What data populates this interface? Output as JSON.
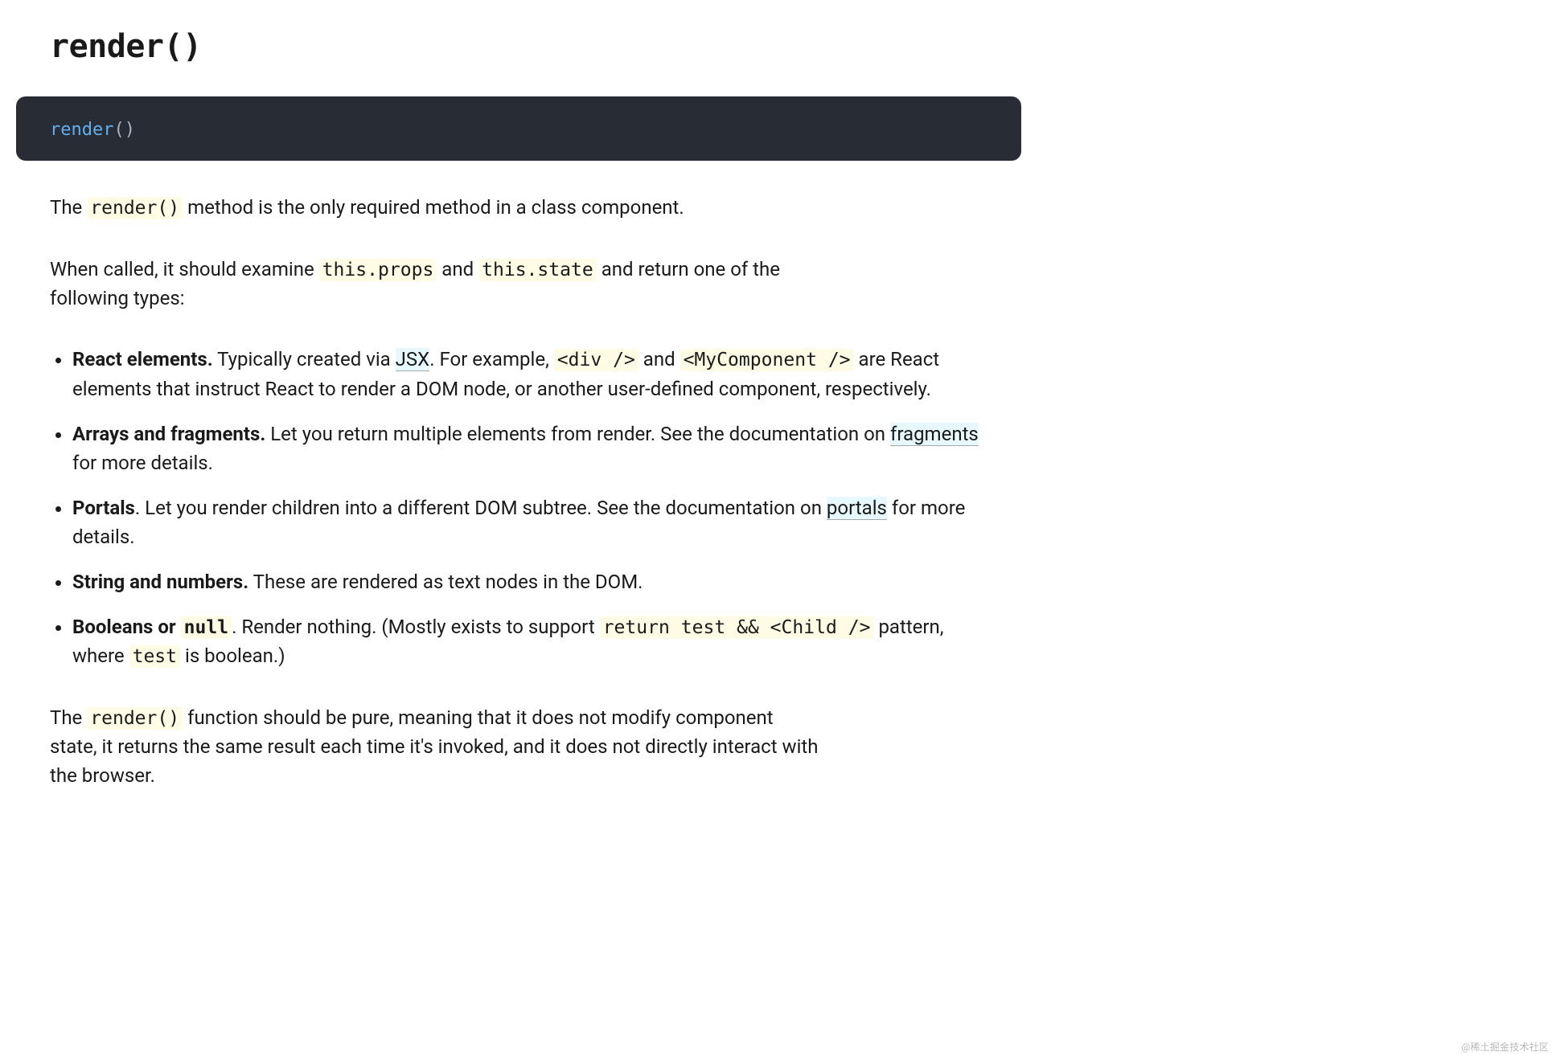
{
  "heading": "render()",
  "codeblock": {
    "fn": "render",
    "parens": "()"
  },
  "p1": {
    "before": "The ",
    "code": "render()",
    "after": " method is the only required method in a class component."
  },
  "p2": {
    "a": "When called, it should examine ",
    "code1": "this.props",
    "b": " and ",
    "code2": "this.state",
    "c": " and return one of the following types:"
  },
  "items": {
    "react_elements": {
      "label": "React elements.",
      "t1": " Typically created via ",
      "jsx": "JSX",
      "t2": ". For example, ",
      "code1": "<div />",
      "t3": " and ",
      "code2": "<MyComponent />",
      "t4": " are React elements that instruct React to render a DOM node, or another user-defined component, respectively."
    },
    "arrays": {
      "label": "Arrays and fragments.",
      "t1": " Let you return multiple elements from render. See the documentation on ",
      "link": "fragments",
      "t2": " for more details."
    },
    "portals": {
      "label": "Portals",
      "t1": ". Let you render children into a different DOM subtree. See the documentation on ",
      "link": "portals",
      "t2": " for more details."
    },
    "strings": {
      "label": "String and numbers.",
      "t1": " These are rendered as text nodes in the DOM."
    },
    "booleans": {
      "label_a": "Booleans or ",
      "code_label": "null",
      "t1": ". Render nothing. (Mostly exists to support ",
      "code1": "return test && <Child />",
      "t2": " pattern, where ",
      "code2": "test",
      "t3": " is boolean.)"
    }
  },
  "p3": {
    "a": "The ",
    "code": "render()",
    "b": " function should be pure, meaning that it does not modify component state, it returns the same result each time it's invoked, and it does not directly interact with the browser."
  },
  "watermark": "@稀土掘金技术社区"
}
